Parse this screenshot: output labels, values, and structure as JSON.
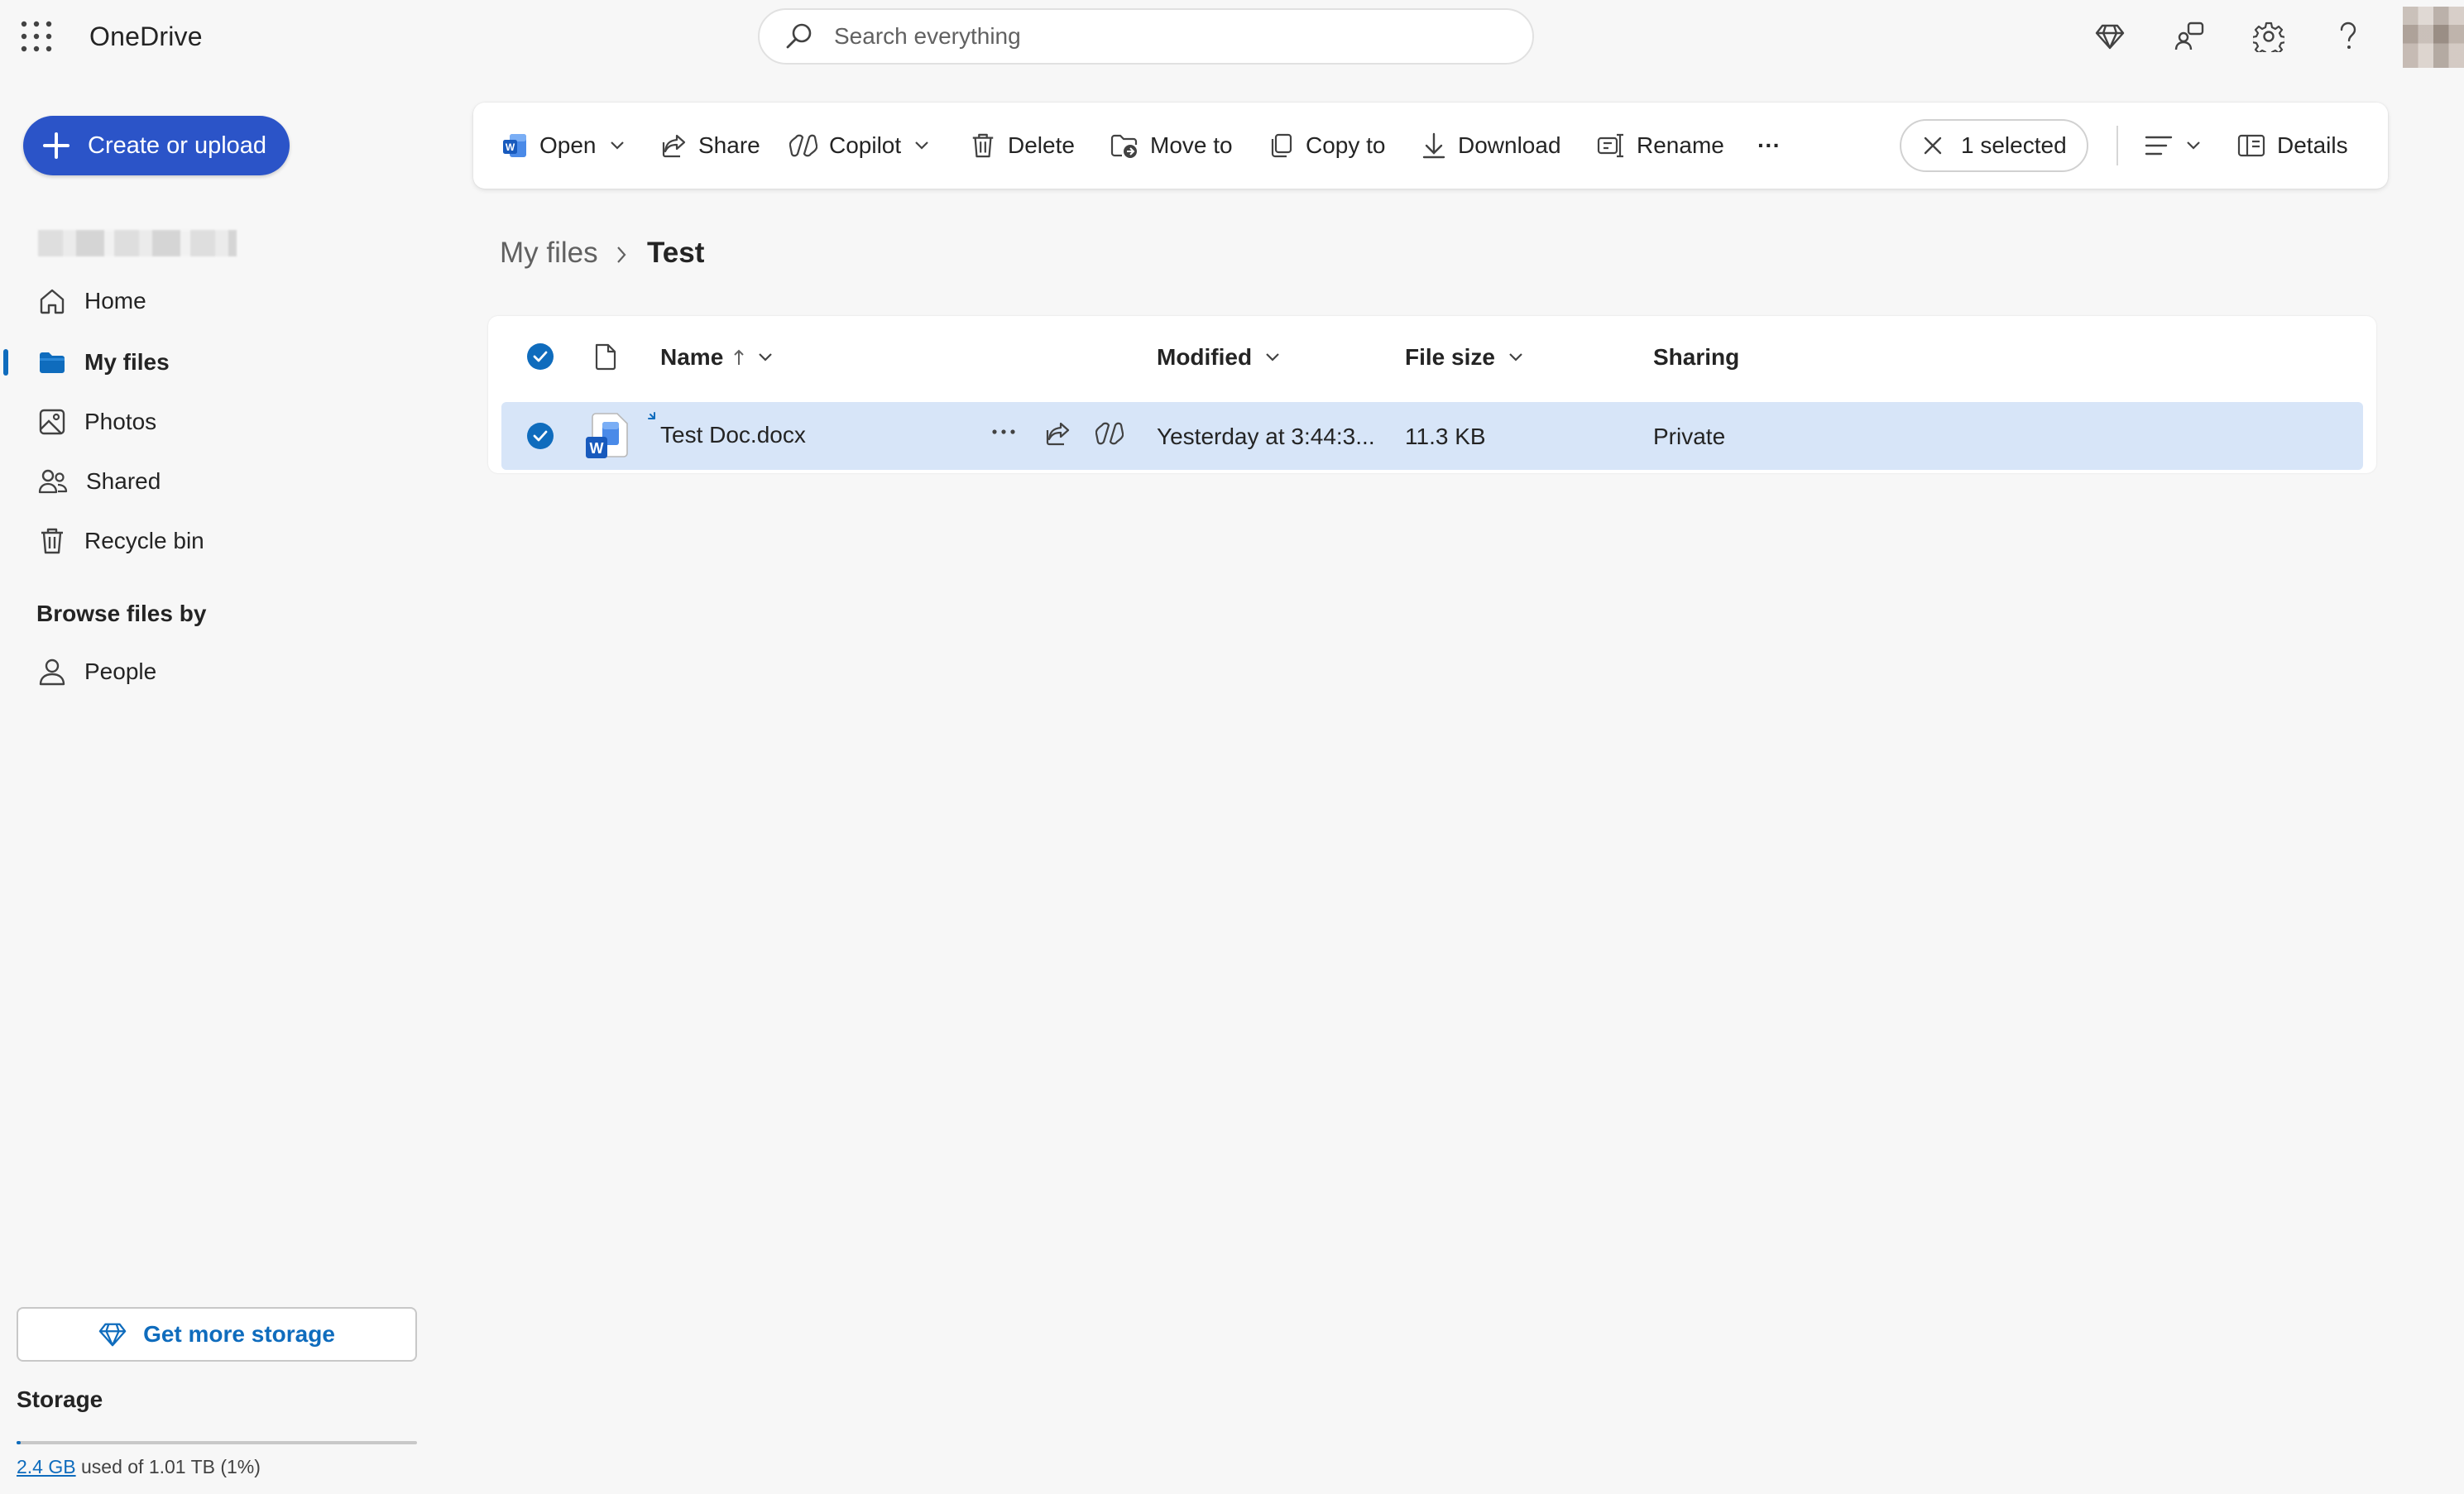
{
  "app": {
    "title": "OneDrive"
  },
  "search": {
    "placeholder": "Search everything"
  },
  "sidebar": {
    "create_label": "Create or upload",
    "items": [
      {
        "label": "Home",
        "icon": "home-icon"
      },
      {
        "label": "My files",
        "icon": "folder-icon",
        "active": true
      },
      {
        "label": "Photos",
        "icon": "photos-icon"
      },
      {
        "label": "Shared",
        "icon": "shared-people-icon"
      },
      {
        "label": "Recycle bin",
        "icon": "recycle-bin-icon"
      }
    ],
    "browse_heading": "Browse files by",
    "browse_items": [
      {
        "label": "People",
        "icon": "person-icon"
      }
    ],
    "storage": {
      "button_label": "Get more storage",
      "title": "Storage",
      "used_link": "2.4 GB",
      "used_text": "used of 1.01 TB (1%)",
      "percent_used": 1
    }
  },
  "commandbar": {
    "open": "Open",
    "share": "Share",
    "copilot": "Copilot",
    "delete": "Delete",
    "move_to": "Move to",
    "copy_to": "Copy to",
    "download": "Download",
    "rename": "Rename",
    "more": "···",
    "selected": "1 selected",
    "details": "Details"
  },
  "breadcrumb": {
    "root": "My files",
    "current": "Test"
  },
  "list": {
    "columns": {
      "name": "Name",
      "modified": "Modified",
      "size": "File size",
      "sharing": "Sharing"
    },
    "rows": [
      {
        "name": "Test Doc.docx",
        "modified": "Yesterday at 3:44:3...",
        "size": "11.3 KB",
        "sharing": "Private",
        "selected": true
      }
    ]
  },
  "colors": {
    "accent": "#0f6cbd",
    "create_button": "#2b54c8",
    "selected_row": "#d7e5f8",
    "word": "#185abd"
  }
}
